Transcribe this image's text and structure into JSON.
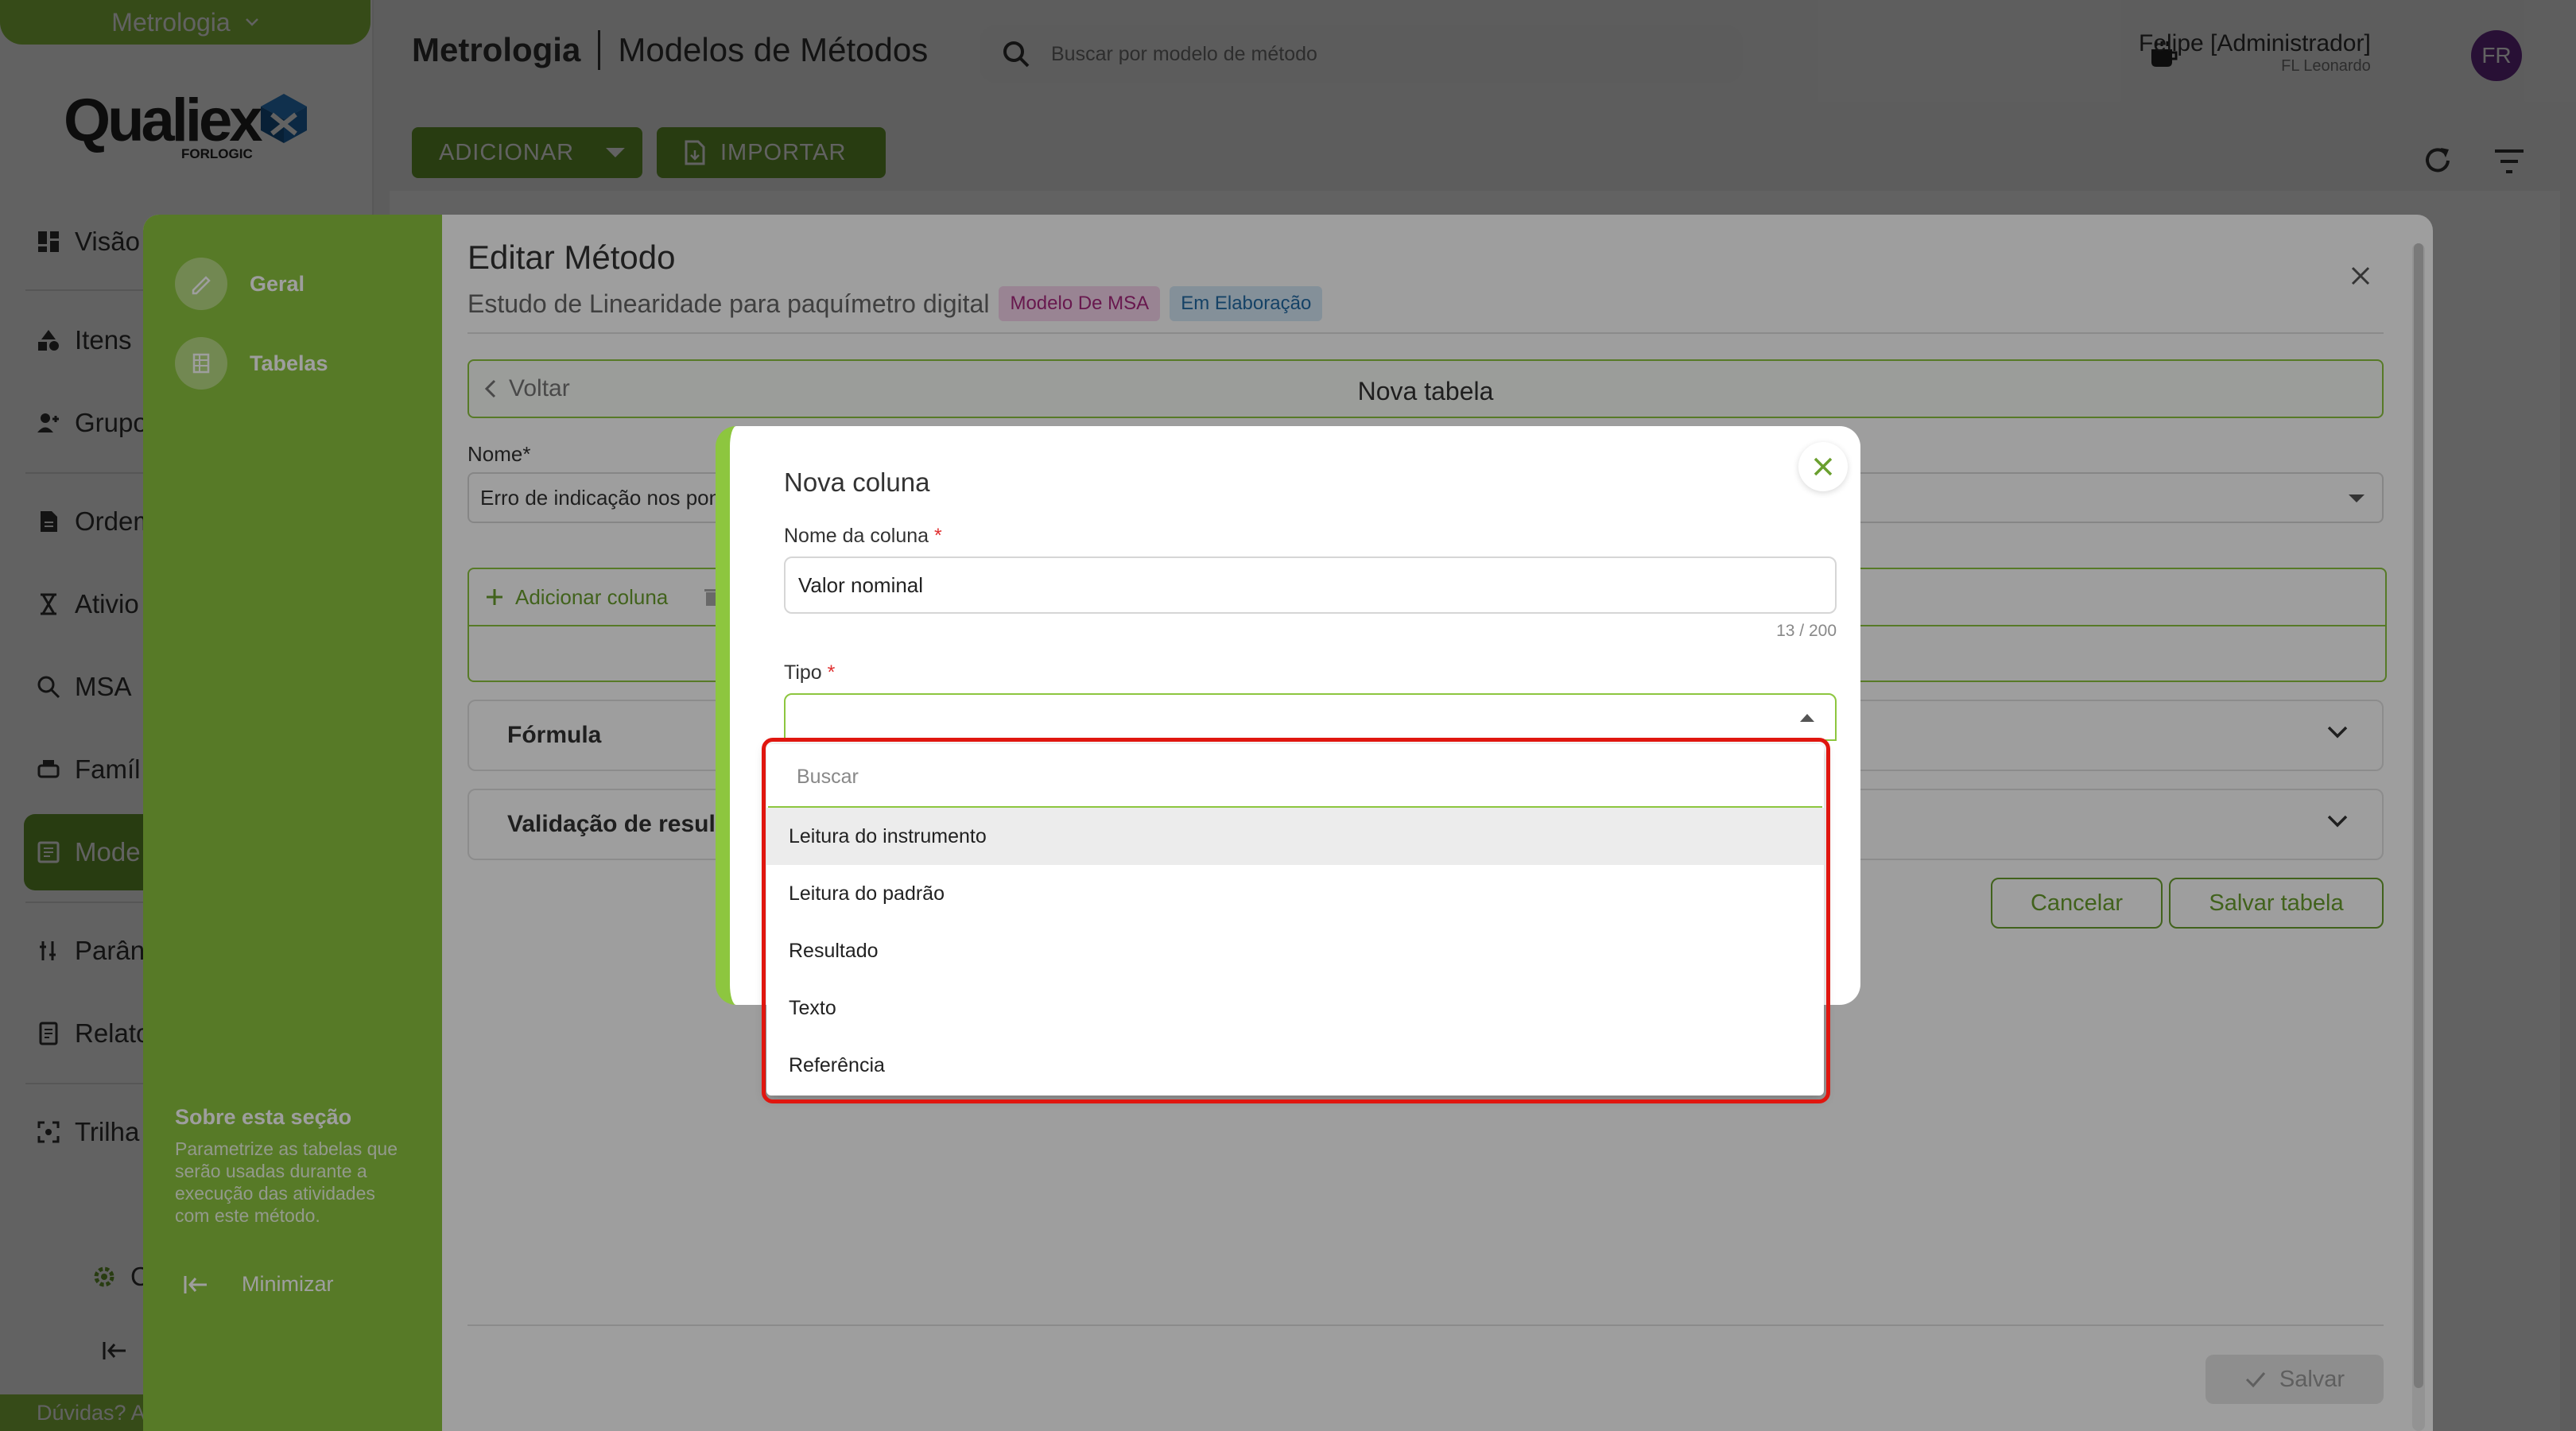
{
  "app": {
    "module": "Metrologia",
    "logo_text": "Qualiex",
    "logo_sub": "FORLOGIC",
    "help": "Dúvidas? A"
  },
  "sidebar": {
    "items": [
      {
        "label": "Visão",
        "icon": "dashboard-icon"
      },
      {
        "label": "Itens",
        "icon": "shapes-icon"
      },
      {
        "label": "Grupo",
        "icon": "users-icon"
      },
      {
        "label": "Ordem",
        "icon": "document-icon"
      },
      {
        "label": "Ativio",
        "icon": "hourglass-icon"
      },
      {
        "label": "MSA",
        "icon": "search-icon"
      },
      {
        "label": "Famíl",
        "icon": "printer-icon"
      },
      {
        "label": "Mode",
        "icon": "book-icon"
      },
      {
        "label": "Parân",
        "icon": "sliders-icon"
      },
      {
        "label": "Relato",
        "icon": "report-icon"
      },
      {
        "label": "Trilha",
        "icon": "scan-icon"
      }
    ],
    "config_label": "C"
  },
  "header": {
    "module_title": "Metrologia",
    "page_title": "Modelos de Métodos",
    "search_placeholder": "Buscar por modelo de método",
    "user_name": "Felipe [Administrador]",
    "user_company": "FL Leonardo",
    "avatar_initials": "FR"
  },
  "toolbar": {
    "add_label": "ADICIONAR",
    "import_label": "IMPORTAR"
  },
  "drawer": {
    "nav": [
      {
        "label": "Geral",
        "icon": "pen-icon"
      },
      {
        "label": "Tabelas",
        "icon": "table-icon"
      }
    ],
    "about_title": "Sobre esta seção",
    "about_text": "Parametrize as tabelas que serão usadas durante a execução das atividades com este método.",
    "minimize_label": "Minimizar",
    "title": "Editar Método",
    "subtitle": "Estudo de Linearidade para paquímetro digital",
    "tag_msa": "Modelo De MSA",
    "tag_status": "Em Elaboração",
    "back_label": "Voltar",
    "new_table_title": "Nova tabela",
    "name_label": "Nome*",
    "name_value": "Erro de indicação nos pon",
    "add_column_label": "Adicionar coluna",
    "formula_label": "Fórmula",
    "validation_label": "Validação de result",
    "cancel_label": "Cancelar",
    "save_table_label": "Salvar tabela",
    "save_label": "Salvar"
  },
  "modal": {
    "title": "Nova coluna",
    "column_name_label": "Nome da coluna",
    "column_name_value": "Valor nominal",
    "char_count": "13 / 200",
    "type_label": "Tipo",
    "required_mark": "*"
  },
  "dropdown": {
    "search_placeholder": "Buscar",
    "options": [
      "Leitura do instrumento",
      "Leitura do padrão",
      "Resultado",
      "Texto",
      "Referência"
    ],
    "highlighted_index": 0
  },
  "colors": {
    "brand_green": "#8dc63f",
    "dark_green": "#6a9f2e",
    "highlight_red": "#e0160f",
    "tag_msa_bg": "#f7d6ee",
    "tag_status_bg": "#d6e8f7"
  }
}
